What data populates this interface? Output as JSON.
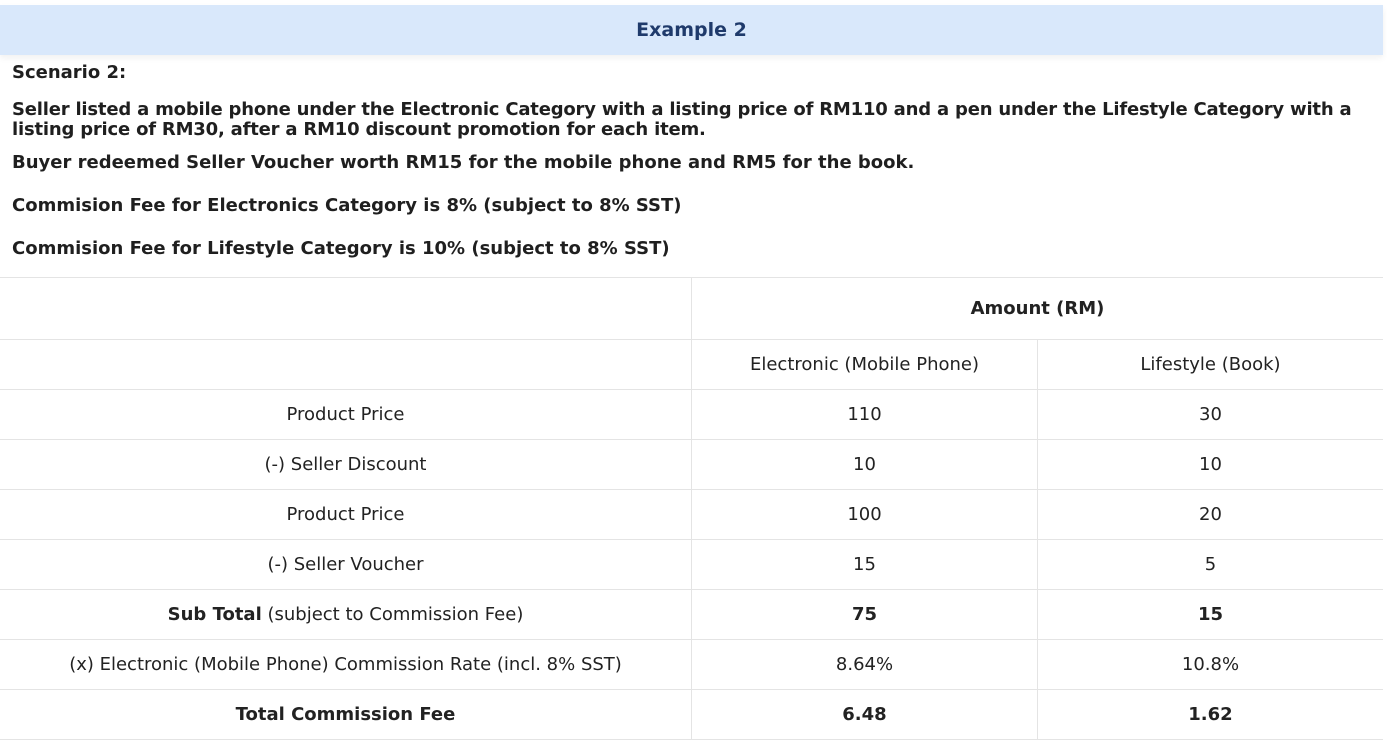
{
  "header": {
    "title": "Example 2"
  },
  "scenario": {
    "title": "Scenario 2:",
    "line1": "Seller listed a mobile phone under the Electronic Category with a listing price of RM110 and a pen under the Lifestyle Category with a listing price of RM30, after a RM10 discount promotion for each item.",
    "line2": "Buyer redeemed Seller Voucher worth RM15 for the mobile phone and RM5 for the book.",
    "line3": "Commision Fee for Electronics Category is 8% (subject to 8% SST)",
    "line4": "Commision Fee for Lifestyle Category is 10% (subject to 8% SST)"
  },
  "table": {
    "amount_header": "Amount (RM)",
    "columns": [
      "Electronic (Mobile Phone)",
      "Lifestyle (Book)"
    ],
    "rows": [
      {
        "label": "Product Price",
        "electronic": "110",
        "lifestyle": "30"
      },
      {
        "label": "(-) Seller Discount",
        "electronic": "10",
        "lifestyle": "10"
      },
      {
        "label": "Product Price",
        "electronic": "100",
        "lifestyle": "20"
      },
      {
        "label": "(-) Seller Voucher",
        "electronic": "15",
        "lifestyle": "5"
      },
      {
        "label_bold": "Sub Total",
        "label_rest": " (subject to Commission Fee)",
        "electronic": "75",
        "lifestyle": "15"
      },
      {
        "label": "(x) Electronic (Mobile Phone) Commission Rate (incl. 8% SST)",
        "electronic": "8.64%",
        "lifestyle": "10.8%"
      },
      {
        "label": "Total Commission Fee",
        "electronic": "6.48",
        "lifestyle": "1.62"
      }
    ]
  }
}
